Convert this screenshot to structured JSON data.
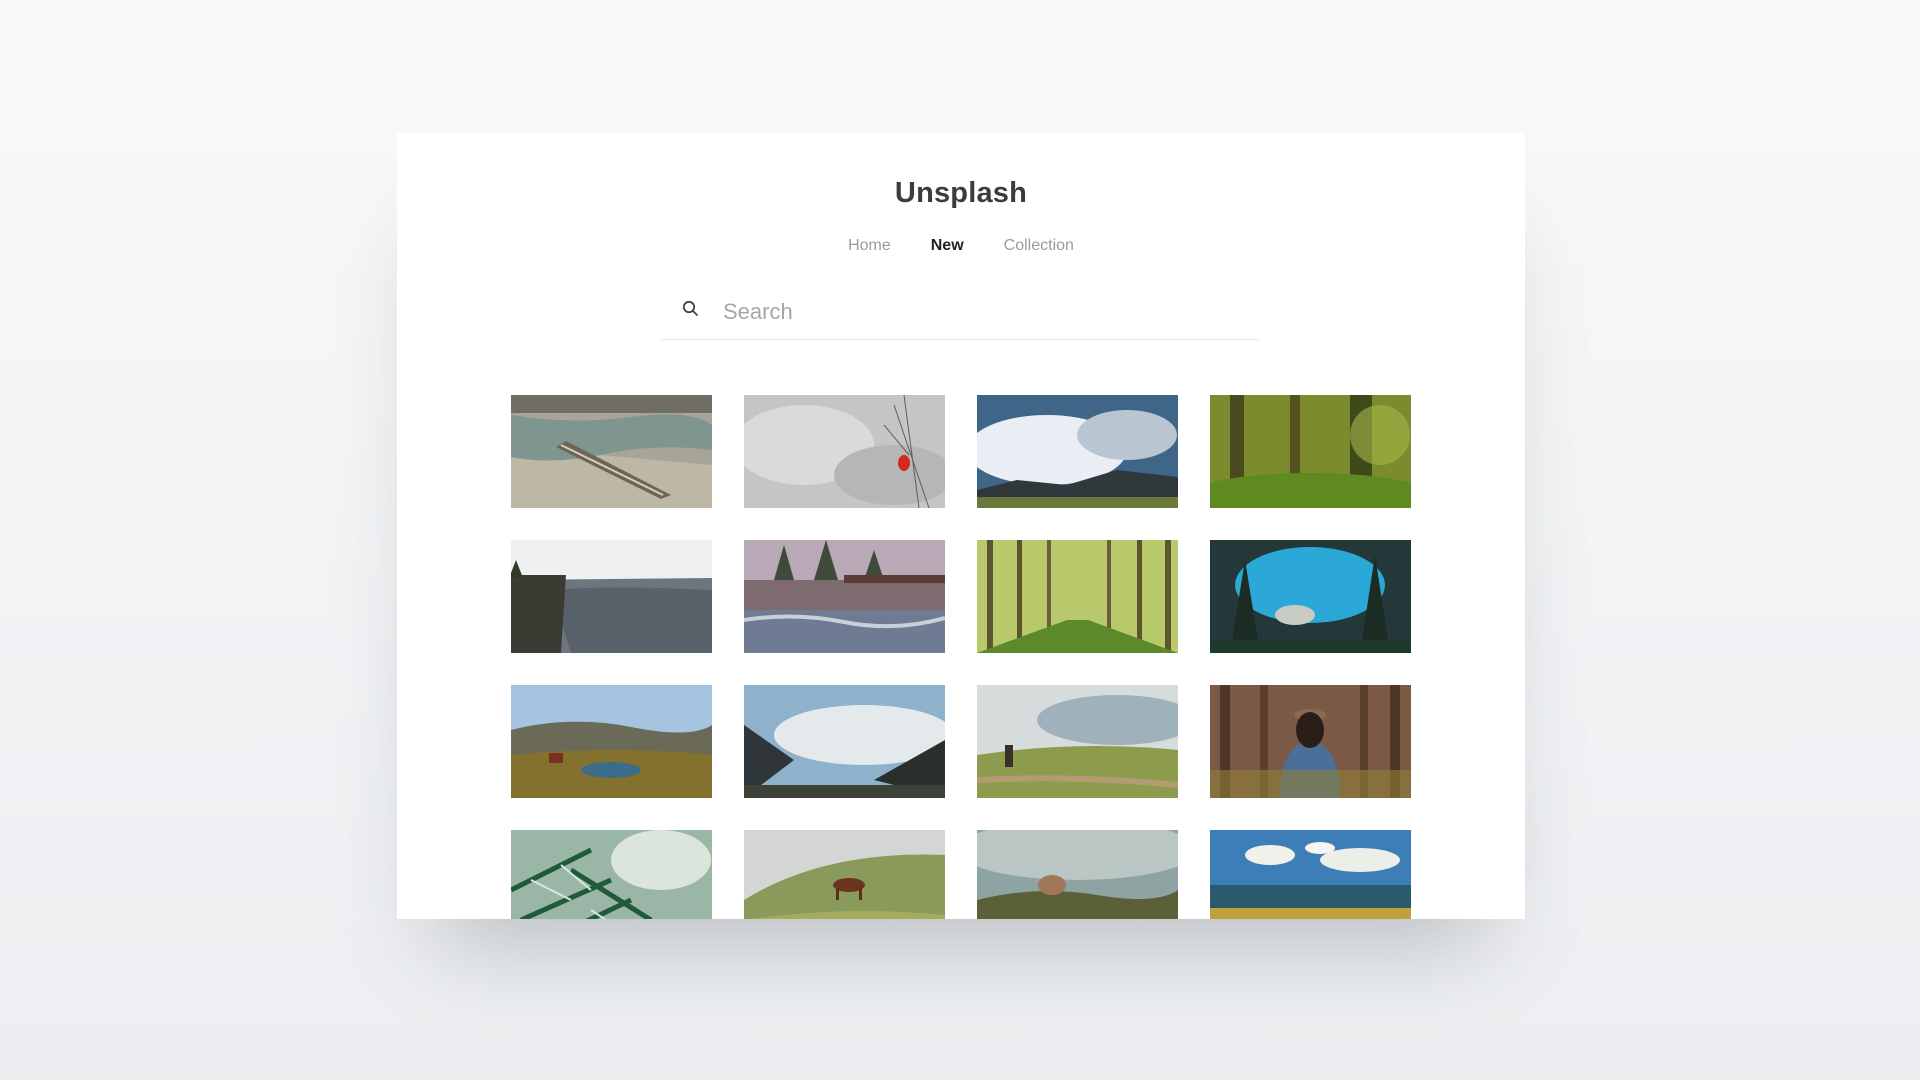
{
  "app": {
    "title": "Unsplash"
  },
  "nav": [
    {
      "label": "Home",
      "active": false
    },
    {
      "label": "New",
      "active": true
    },
    {
      "label": "Collection",
      "active": false
    }
  ],
  "search": {
    "placeholder": "Search",
    "value": "",
    "icon": "search-icon"
  },
  "colors": {
    "title": "#3c3c3c",
    "nav_inactive": "#9b9b9b",
    "nav_active": "#222222",
    "background": "#f3f4f6"
  },
  "photos": [
    {
      "subject": "wooden canoe on a rocky river shore"
    },
    {
      "subject": "red cardinal among pale reeds"
    },
    {
      "subject": "dramatic clouds over mountain valley"
    },
    {
      "subject": "mossy green forest"
    },
    {
      "subject": "granite cliff overlooking valley"
    },
    {
      "subject": "wooden bridge over rushing river"
    },
    {
      "subject": "avenue of tall poplar trees"
    },
    {
      "subject": "turquoise lake framed by pines"
    },
    {
      "subject": "small cabin beside mountain pond"
    },
    {
      "subject": "clouds drifting through forested valley"
    },
    {
      "subject": "rider on horseback in misty meadow"
    },
    {
      "subject": "woman in hat facing a forest"
    },
    {
      "subject": "close-up of pine needles"
    },
    {
      "subject": "horse grazing on a grassy hill"
    },
    {
      "subject": "blurred plants close-up"
    },
    {
      "subject": "sea horizon with clouds and golden grass"
    }
  ]
}
